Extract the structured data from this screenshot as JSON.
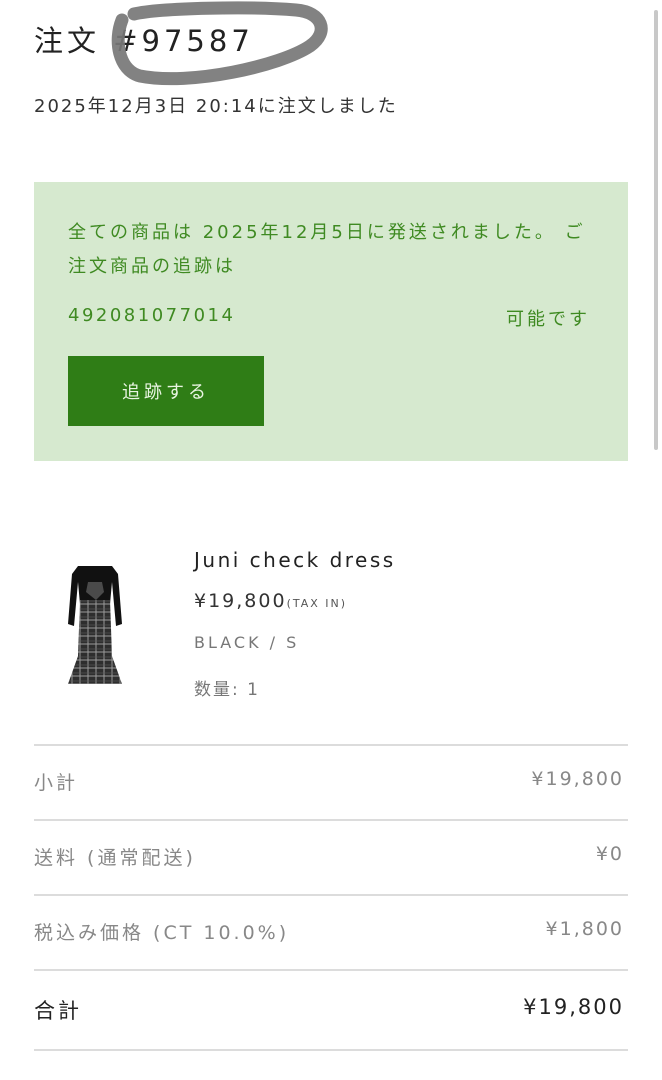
{
  "order": {
    "title": "注文 #97587",
    "date_text": "2025年12月3日 20:14に注文しました"
  },
  "shipping": {
    "message": "全ての商品は 2025年12月5日に発送されました。 ご注文商品の追跡は",
    "tracking_number": "492081077014",
    "available_text": "可能です",
    "track_button_label": "追跡する",
    "colors": {
      "box_background": "#d6e9cf",
      "text": "#3f8a22",
      "button": "#2f7d16"
    }
  },
  "product": {
    "name": "Juni check dress",
    "price": "¥19,800",
    "tax_note": "(TAX IN)",
    "variant": "BLACK / S",
    "quantity_text": "数量: 1",
    "image_icon": "dress-thumbnail"
  },
  "summary": {
    "rows": [
      {
        "label": "小計",
        "value": "¥19,800"
      },
      {
        "label": "送料 (通常配送)",
        "value": "¥0"
      },
      {
        "label": "税込み価格 (CT 10.0%)",
        "value": "¥1,800"
      },
      {
        "label": "合計",
        "value": "¥19,800"
      }
    ]
  }
}
